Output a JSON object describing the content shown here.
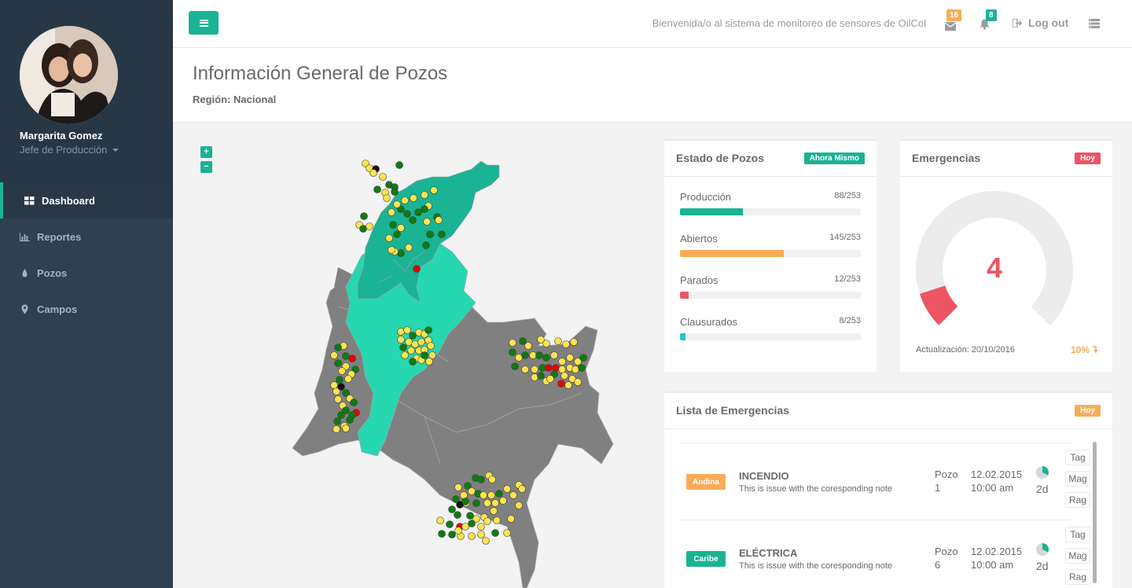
{
  "user": {
    "name": "Margarita Gomez",
    "role": "Jefe de Producción"
  },
  "nav": [
    {
      "label": "Dashboard",
      "icon": "dashboard-icon"
    },
    {
      "label": "Reportes",
      "icon": "bar-chart-icon"
    },
    {
      "label": "Pozos",
      "icon": "drop-icon"
    },
    {
      "label": "Campos",
      "icon": "map-marker-icon"
    }
  ],
  "topbar": {
    "welcome": "Bienvenida/o al sistema de monitoreo de sensores de OilCol",
    "messages_count": "16",
    "alerts_count": "8",
    "logout": "Log out"
  },
  "page": {
    "title": "Información General de Pozos",
    "region": "Región: Nacional"
  },
  "map": {
    "zoom_in": "+",
    "zoom_out": "−"
  },
  "estado": {
    "title": "Estado de Pozos",
    "badge": "Ahora Mismo",
    "items": [
      {
        "label": "Producción",
        "value": "88/253",
        "fraction": 0.348,
        "color": "#1ab394"
      },
      {
        "label": "Abiertos",
        "value": "145/253",
        "fraction": 0.573,
        "color": "#f8ac59"
      },
      {
        "label": "Parados",
        "value": "12/253",
        "fraction": 0.047,
        "color": "#ed5565"
      },
      {
        "label": "Clausurados",
        "value": "8/253",
        "fraction": 0.032,
        "color": "#23c6c8"
      }
    ]
  },
  "emergencias": {
    "title": "Emergencias",
    "badge": "Hoy",
    "count": "4",
    "gauge_fraction": 0.1,
    "updated": "Actualización: 20/10/2016",
    "change": "10%"
  },
  "lista": {
    "title": "Lista de Emergencias",
    "badge": "Hoy",
    "rows": [
      {
        "tag": "Andina",
        "tag_color": "#f8ac59",
        "title": "INCENDIO",
        "desc": "This is issue with the coresponding note",
        "pozo": "Pozo",
        "pozo_num": "1",
        "date": "12.02.2015",
        "time": "10:00 am",
        "days": "2d"
      },
      {
        "tag": "Caribe",
        "tag_color": "#1ab394",
        "title": "ELÉCTRICA",
        "desc": "This is issue with the coresponding note",
        "pozo": "Pozo",
        "pozo_num": "6",
        "date": "12.02.2015",
        "time": "10:00 am",
        "days": "2d"
      }
    ],
    "buttons": [
      "Tag",
      "Mag",
      "Rag"
    ]
  },
  "colors": {
    "accent": "#1ab394",
    "sidebar": "#2f4050",
    "danger": "#ed5565",
    "warning": "#f8ac59"
  }
}
